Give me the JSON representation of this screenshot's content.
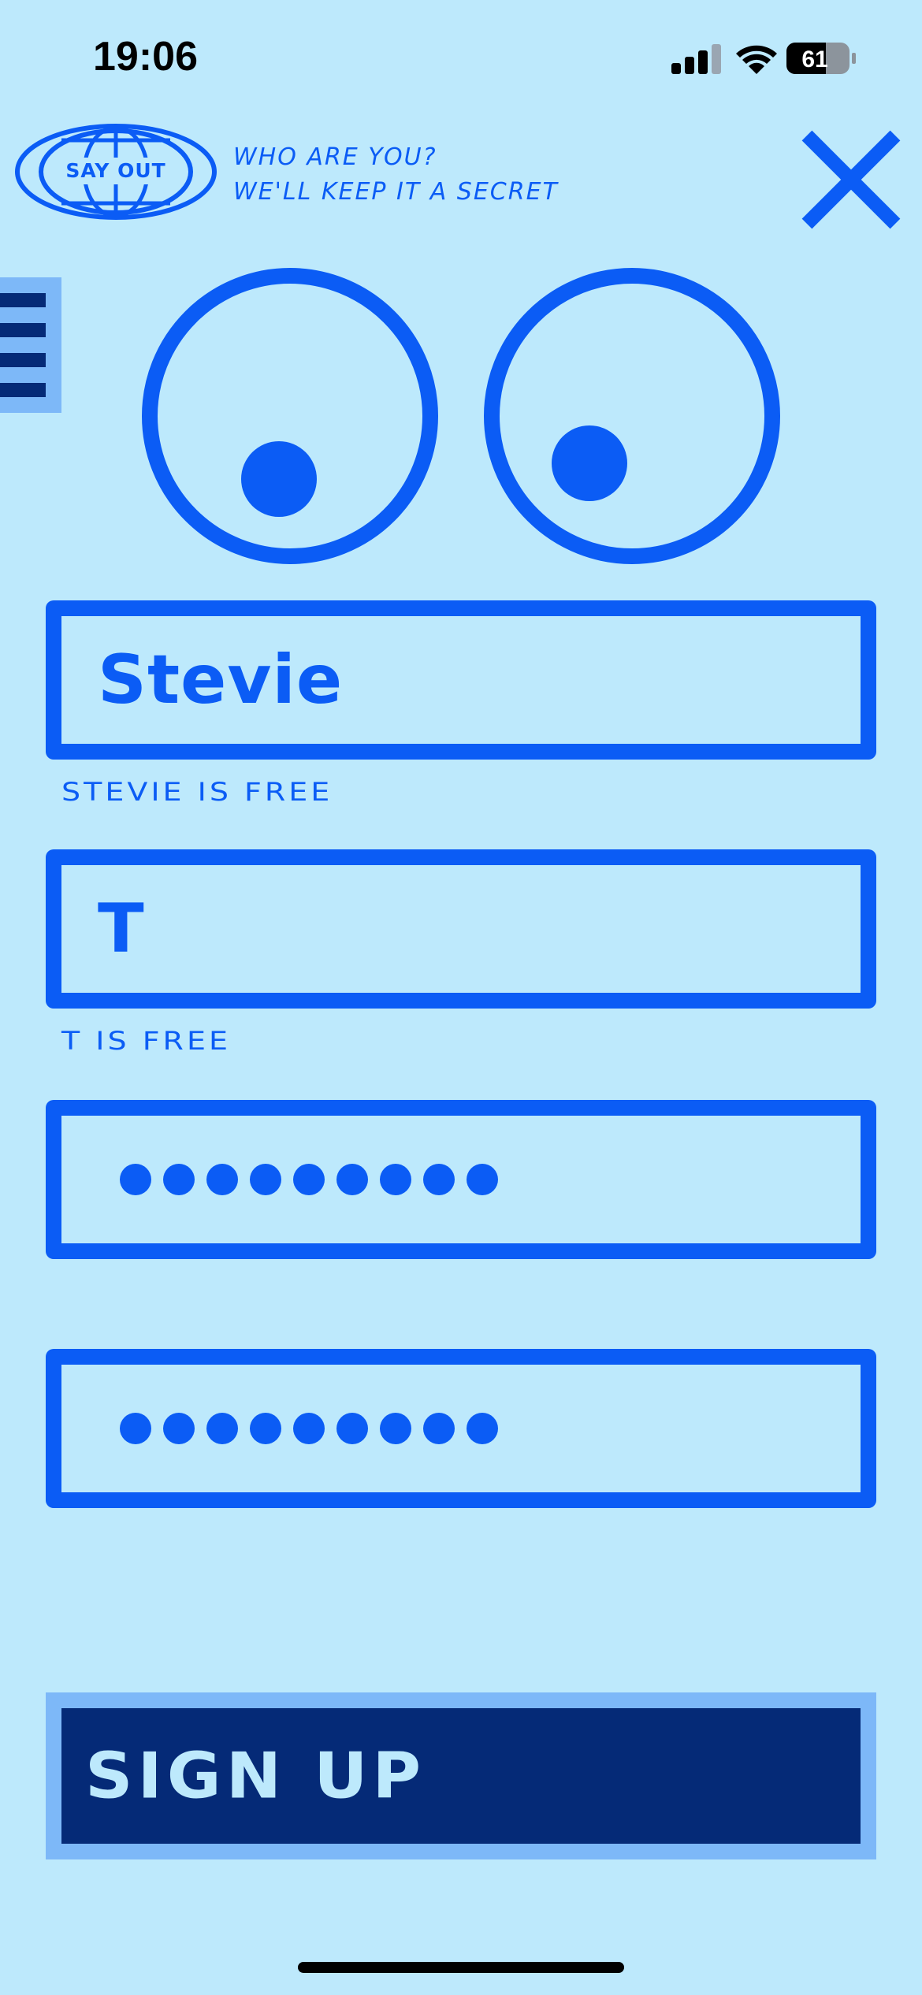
{
  "status_bar": {
    "time": "19:06",
    "battery": "61"
  },
  "header": {
    "logo_text": "SAY OUT",
    "tagline_line1": "WHO ARE YOU?",
    "tagline_line2": "WE'LL KEEP IT A SECRET"
  },
  "form": {
    "first_name_value": "Stevie",
    "first_name_hint": "STEVIE  IS FREE",
    "last_name_value": "T",
    "last_name_hint": "T  IS FREE",
    "password_dots": 9,
    "confirm_password_dots": 9
  },
  "signup_label": "SIGN UP",
  "colors": {
    "background": "#bde9fc",
    "primary": "#0b5cf5",
    "dark": "#052a77",
    "accent_light": "#7db8f8"
  }
}
